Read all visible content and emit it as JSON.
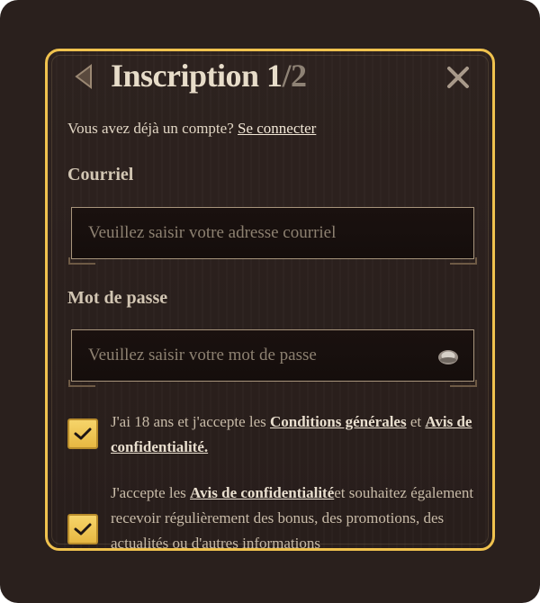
{
  "modal": {
    "title_main": "Inscription 1",
    "title_sep": "/2",
    "back_icon": "chevron-left-icon",
    "close_icon": "close-icon"
  },
  "login": {
    "prompt": "Vous avez déjà un compte?",
    "link": "Se connecter"
  },
  "email": {
    "label": "Courriel",
    "placeholder": "Veuillez saisir votre adresse courriel",
    "value": ""
  },
  "password": {
    "label": "Mot de passe",
    "placeholder": "Veuillez saisir votre mot de passe",
    "value": "",
    "toggle_icon": "eye-icon"
  },
  "consent": [
    {
      "checked": true,
      "text_before": "J'ai 18 ans et j'accepte les ",
      "link1": "Conditions générales",
      "text_between": " et ",
      "link2": "Avis de confidentialité."
    },
    {
      "checked": true,
      "text_before": "J'accepte les ",
      "link1": "Avis de confidentialité",
      "text_after": "et souhaitez également recevoir régulièrement des bonus, des promotions, des actualités ou d'autres informations"
    }
  ],
  "colors": {
    "window_bg": "#2a201d",
    "modal_border": "#f0c24e",
    "checkbox": "#f0c24e",
    "text_primary": "#e7dcc9",
    "text_muted": "#8e8275"
  }
}
